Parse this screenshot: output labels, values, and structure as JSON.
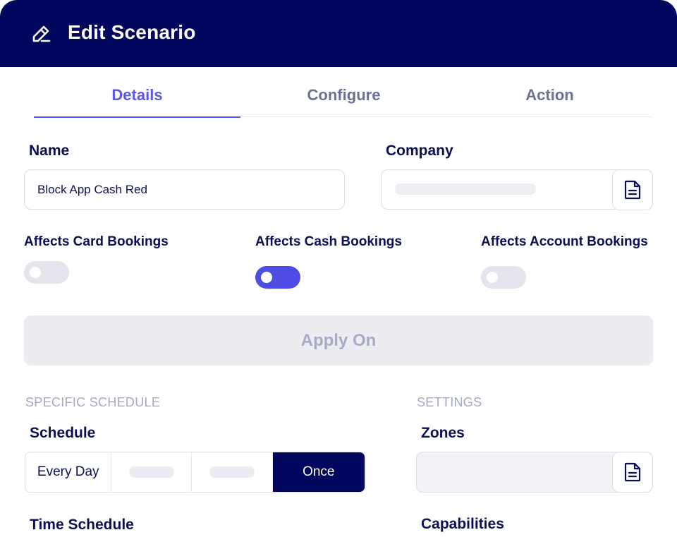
{
  "header": {
    "title": "Edit Scenario",
    "icon": "pencil-edit-icon"
  },
  "tabs": [
    {
      "label": "Details",
      "active": true
    },
    {
      "label": "Configure",
      "active": false
    },
    {
      "label": "Action",
      "active": false
    }
  ],
  "name_field": {
    "label": "Name",
    "value": "Block App Cash Red"
  },
  "company_field": {
    "label": "Company",
    "value": "",
    "icon": "document-icon"
  },
  "toggles": [
    {
      "label": "Affects Card Bookings",
      "on": false
    },
    {
      "label": "Affects Cash Bookings",
      "on": true
    },
    {
      "label": "Affects Account Bookings",
      "on": false
    }
  ],
  "apply_button": {
    "label": "Apply On"
  },
  "schedule_section": {
    "section_label": "SPECIFIC SCHEDULE",
    "label": "Schedule",
    "options": [
      {
        "label": "Every Day",
        "active": false
      },
      {
        "label": "",
        "active": false
      },
      {
        "label": "",
        "active": false
      },
      {
        "label": "Once",
        "active": true
      }
    ],
    "time_schedule_label": "Time Schedule"
  },
  "settings_section": {
    "section_label": "SETTINGS",
    "zones_label": "Zones",
    "capabilities_label": "Capabilities"
  },
  "colors": {
    "header_bg": "#03075e",
    "accent": "#5b57e8",
    "toggle_on": "#4f4ce6",
    "text_dark": "#0b0f55"
  }
}
